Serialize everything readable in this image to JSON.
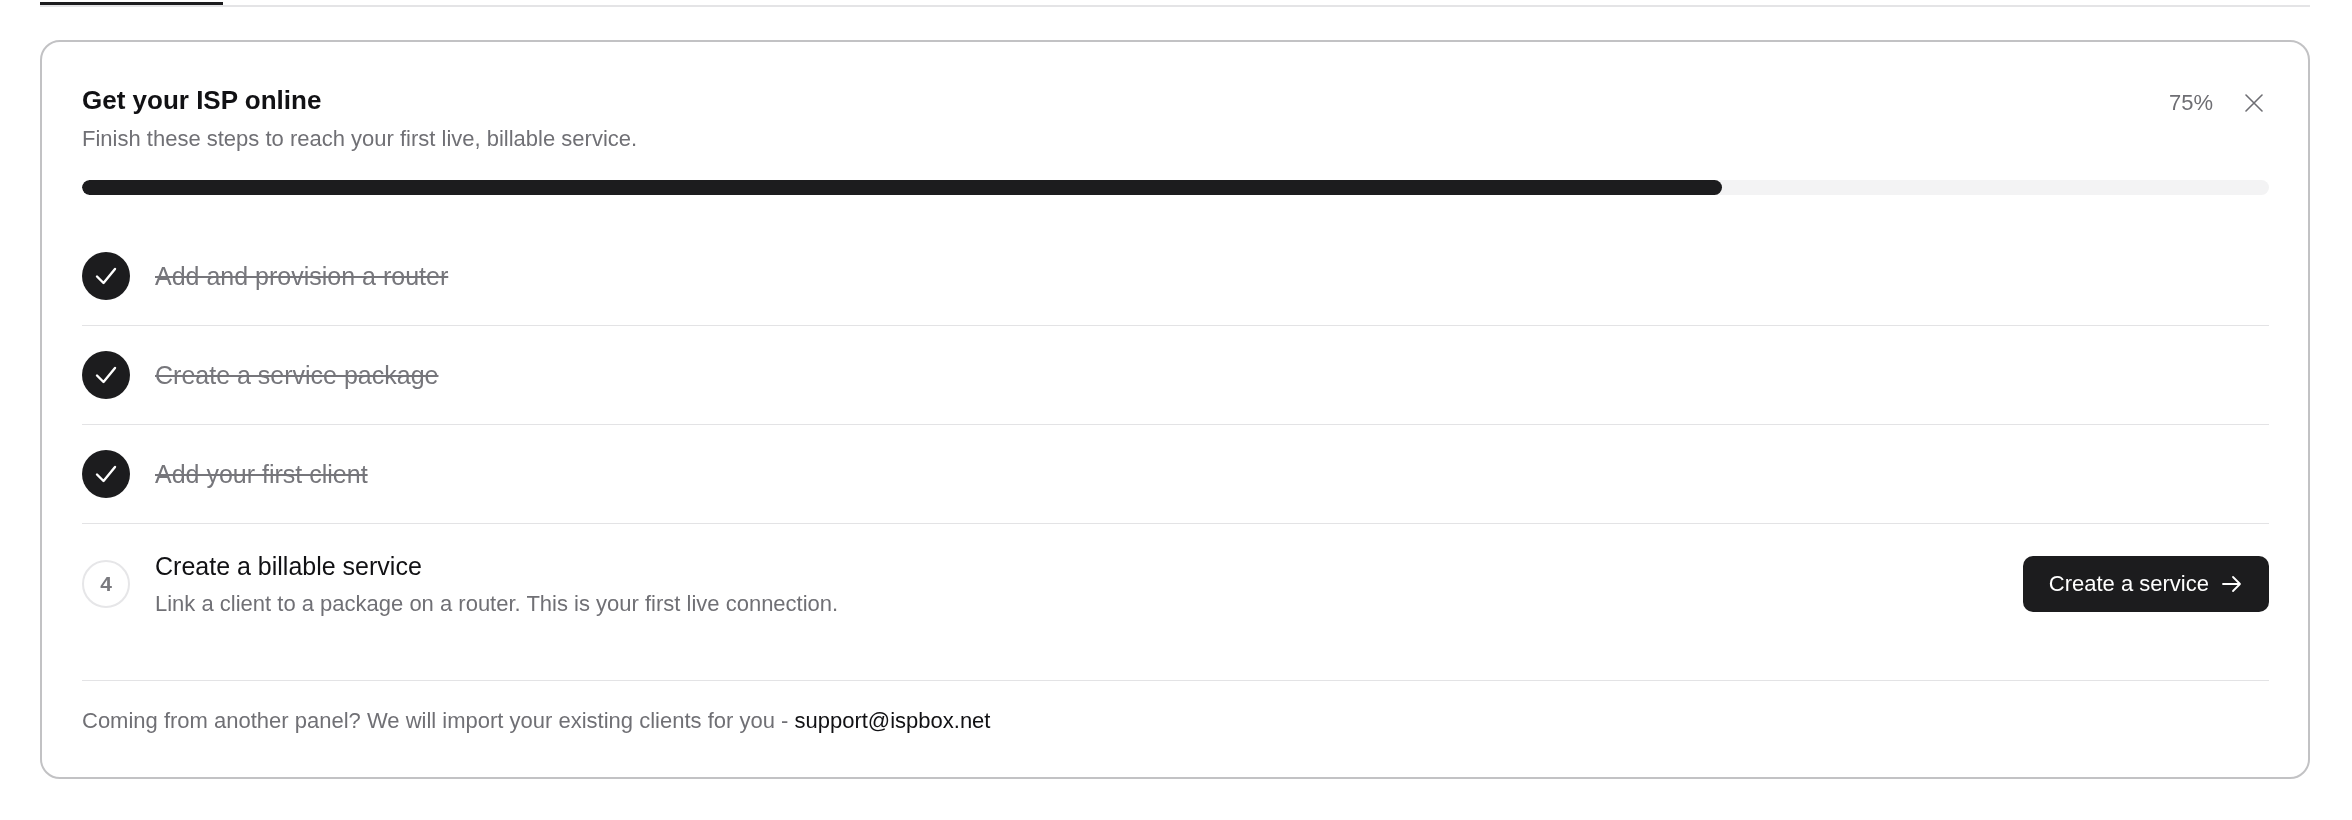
{
  "onboarding": {
    "title": "Get your ISP online",
    "subtitle": "Finish these steps to reach your first live, billable service.",
    "percent": "75%",
    "progress": {
      "level": 0.75
    },
    "steps": [
      {
        "title": "Add and provision a router",
        "completed": true
      },
      {
        "title": "Create a service package",
        "completed": true
      },
      {
        "title": "Add your first client",
        "completed": true
      },
      {
        "title": "Create a billable service",
        "completed": false,
        "number": "4",
        "description": "Link a client to a package on a router. This is your first live connection.",
        "action": "Create a service"
      }
    ],
    "footer": {
      "text": "Coming from another panel? We will import your existing clients for you -",
      "link": "support@ispbox.net"
    }
  }
}
